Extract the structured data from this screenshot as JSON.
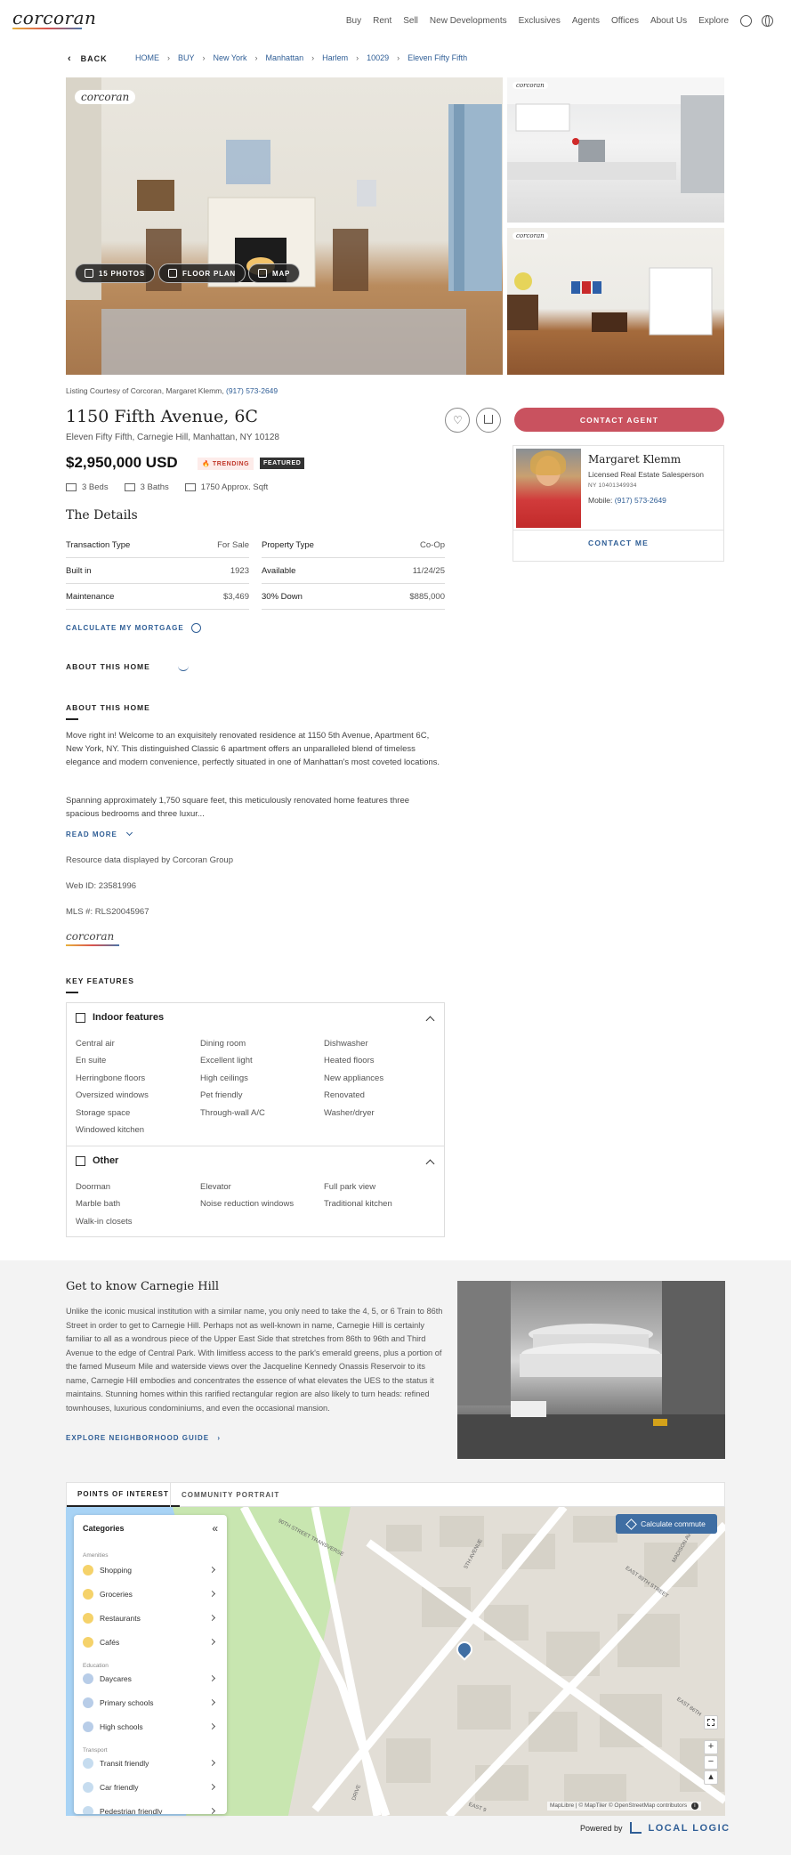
{
  "header": {
    "logo": "corcoran",
    "nav": [
      "Buy",
      "Rent",
      "Sell",
      "New Developments",
      "Exclusives",
      "Agents",
      "Offices",
      "About Us",
      "Explore"
    ]
  },
  "breadcrumb": {
    "back": "BACK",
    "items": [
      "HOME",
      "BUY",
      "New York",
      "Manhattan",
      "Harlem",
      "10029",
      "Eleven Fifty Fifth"
    ]
  },
  "gallery": {
    "watermark": "corcoran",
    "buttons": {
      "photos": "15 PHOTOS",
      "floor_plan": "FLOOR PLAN",
      "map": "MAP"
    }
  },
  "listing": {
    "courtesy_prefix": "Listing Courtesy of Corcoran, Margaret Klemm,",
    "courtesy_phone": "(917) 573-2649",
    "address": "1150 Fifth Avenue, 6C",
    "subaddress": "Eleven Fifty Fifth, Carnegie Hill, Manhattan, NY 10128",
    "price": "$2,950,000 USD",
    "badges": {
      "trending": "TRENDING",
      "featured": "FEATURED"
    },
    "facts": {
      "beds": "3 Beds",
      "baths": "3 Baths",
      "sqft": "1750 Approx. Sqft"
    }
  },
  "details": {
    "title": "The Details",
    "rows": [
      {
        "key": "Transaction Type",
        "value": "For Sale"
      },
      {
        "key": "Property Type",
        "value": "Co-Op"
      },
      {
        "key": "Built in",
        "value": "1923"
      },
      {
        "key": "Available",
        "value": "11/24/25"
      },
      {
        "key": "Maintenance",
        "value": "$3,469"
      },
      {
        "key": "30% Down",
        "value": "$885,000"
      }
    ],
    "mortgage_link": "CALCULATE MY MORTGAGE"
  },
  "about": {
    "collapsed_label": "ABOUT THIS HOME",
    "label": "ABOUT THIS HOME",
    "para1": "Move right in! Welcome to an exquisitely renovated residence at 1150 5th Avenue, Apartment 6C, New York, NY. This distinguished Classic 6 apartment offers an unparalleled blend of timeless elegance and modern convenience, perfectly situated in one of Manhattan's most coveted locations.",
    "para2": "Spanning approximately 1,750 square feet, this meticulously renovated home features three spacious bedrooms and three luxur...",
    "read_more": "READ MORE",
    "resource": "Resource data displayed by Corcoran Group",
    "web_id": "Web ID: 23581996",
    "mls": "MLS #: RLS20045967",
    "logo": "corcoran"
  },
  "key_features": {
    "label": "KEY FEATURES",
    "indoor": {
      "title": "Indoor features",
      "items": [
        "Central air",
        "Dining room",
        "Dishwasher",
        "En suite",
        "Excellent light",
        "Heated floors",
        "Herringbone floors",
        "High ceilings",
        "New appliances",
        "Oversized windows",
        "Pet friendly",
        "Renovated",
        "Storage space",
        "Through-wall A/C",
        "Washer/dryer",
        "Windowed kitchen"
      ]
    },
    "other": {
      "title": "Other",
      "items": [
        "Doorman",
        "Elevator",
        "Full park view",
        "Marble bath",
        "Noise reduction windows",
        "Traditional kitchen",
        "Walk-in closets"
      ]
    }
  },
  "agent": {
    "contact_button": "CONTACT AGENT",
    "name": "Margaret Klemm",
    "title": "Licensed Real Estate Salesperson",
    "license": "NY 10401349934",
    "mobile_label": "Mobile:",
    "mobile": "(917) 573-2649",
    "contact_me": "CONTACT ME"
  },
  "neighborhood": {
    "title": "Get to know Carnegie Hill",
    "text": "Unlike the iconic musical institution with a similar name, you only need to take the 4, 5, or 6 Train to 86th Street in order to get to Carnegie Hill. Perhaps not as well-known in name, Carnegie Hill is certainly familiar to all as a wondrous piece of the Upper East Side that stretches from 86th to 96th and Third Avenue to the edge of Central Park. With limitless access to the park's emerald greens, plus a portion of the famed Museum Mile and waterside views over the Jacqueline Kennedy Onassis Reservoir to its name, Carnegie Hill embodies and concentrates the essence of what elevates the UES to the status it maintains. Stunning homes within this rarified rectangular region are also likely to turn heads: refined townhouses, luxurious condominiums, and even the occasional mansion.",
    "link": "EXPLORE NEIGHBORHOOD GUIDE"
  },
  "map": {
    "tabs": [
      "POINTS OF INTEREST",
      "COMMUNITY PORTRAIT"
    ],
    "panel_title": "Categories",
    "groups": {
      "amenities": "Amenities",
      "education": "Education",
      "transport": "Transport"
    },
    "amenities": [
      "Shopping",
      "Groceries",
      "Restaurants",
      "Cafés"
    ],
    "education": [
      "Daycares",
      "Primary schools",
      "High schools"
    ],
    "transport": [
      "Transit friendly",
      "Car friendly",
      "Pedestrian friendly"
    ],
    "calc_button": "Calculate commute",
    "street_labels": [
      "90TH STREET TRANSVERSE",
      "5TH AVENUE",
      "EAST 89TH STREET",
      "MADISON AVENUE",
      "EAST 86TH",
      "DRIVE",
      "EAST 9"
    ],
    "attribution": "MapLibre | © MapTiler © OpenStreetMap contributors",
    "powered_by": "Powered by",
    "brand": "LOCAL LOGIC"
  },
  "colors": {
    "accent": "#2f5e96",
    "contact": "#c9525f"
  }
}
